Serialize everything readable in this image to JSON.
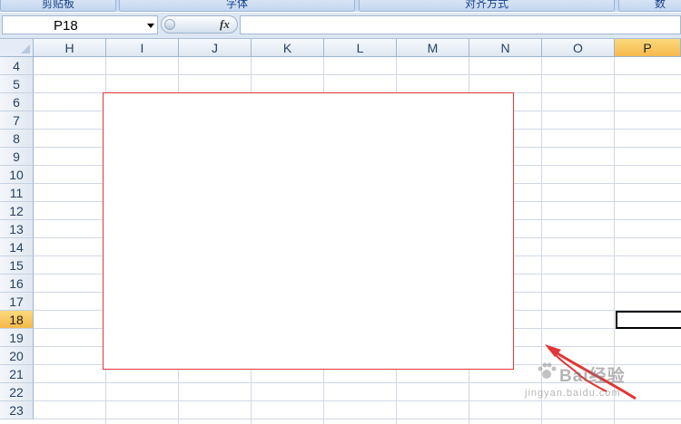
{
  "ribbon": {
    "groups": [
      "剪贴板",
      "字体",
      "对齐方式",
      "数"
    ]
  },
  "formula_bar": {
    "name_box": "P18",
    "fx_label": "fx",
    "formula_value": ""
  },
  "sheet": {
    "columns": [
      "H",
      "I",
      "J",
      "K",
      "L",
      "M",
      "N",
      "O",
      "P"
    ],
    "rows": [
      "4",
      "5",
      "6",
      "7",
      "8",
      "9",
      "10",
      "11",
      "12",
      "13",
      "14",
      "15",
      "16",
      "17",
      "18",
      "19",
      "20",
      "21",
      "22",
      "23"
    ],
    "active_column": "P",
    "active_row": "18"
  },
  "watermark": {
    "text": "Bai经验",
    "sub": "jingyan.baidu.com"
  },
  "colors": {
    "highlight_rect": "#e23535",
    "arrow": "#e23535",
    "active_header": "#f5b94a"
  }
}
